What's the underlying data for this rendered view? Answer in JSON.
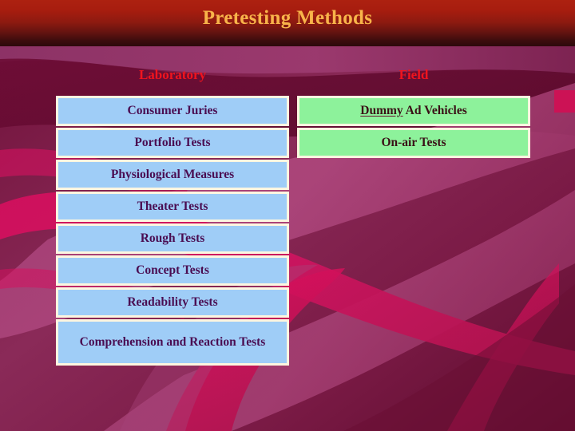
{
  "slide": {
    "title": "Pretesting Methods",
    "title_color": "#f8b44a",
    "banner_color_top": "#ad2110",
    "banner_color_bottom": "#2d090c",
    "background_base_color": "#8e2c5c",
    "background_dark_color": "#6e0f37",
    "background_accent_color": "#d4145c"
  },
  "columns": [
    {
      "id": "laboratory",
      "header": "Laboratory",
      "header_color": "#f0141e",
      "cell_fill": "#9fcdf7",
      "cell_text_color": "#4a0d52",
      "cell_border_color": "#fdf6e0",
      "items": [
        {
          "label": "Consumer Juries",
          "tall": false
        },
        {
          "label": "Portfolio Tests",
          "tall": false
        },
        {
          "label": "Physiological Measures",
          "tall": false
        },
        {
          "label": "Theater Tests",
          "tall": false
        },
        {
          "label": "Rough Tests",
          "tall": false
        },
        {
          "label": "Concept Tests",
          "tall": false
        },
        {
          "label": "Readability Tests",
          "tall": false
        },
        {
          "label": "Comprehension and Reaction Tests",
          "tall": true
        }
      ]
    },
    {
      "id": "field",
      "header": "Field",
      "header_color": "#f0141e",
      "cell_fill": "#8df29b",
      "cell_text_color": "#3a1016",
      "cell_border_color": "#fdf6e0",
      "items": [
        {
          "label": "Dummy Ad Vehicles",
          "underlined_word": "Dummy",
          "tall": false
        },
        {
          "label": "On-air Tests",
          "tall": false
        }
      ]
    }
  ]
}
